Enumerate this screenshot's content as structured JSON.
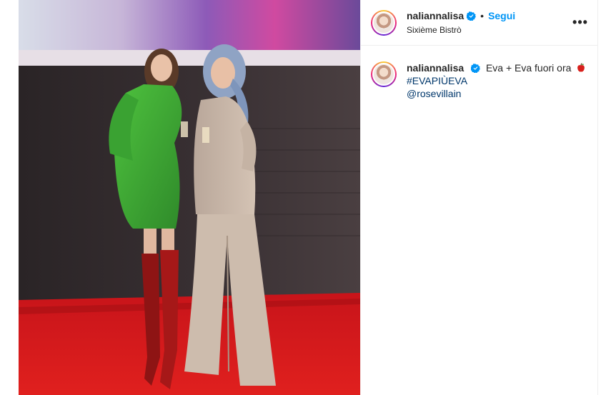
{
  "post": {
    "username": "naliannalisa",
    "follow_label": "Segui",
    "separator": "•",
    "location": "Sixième Bistrò",
    "more_label": "•••",
    "caption": {
      "username": "naliannalisa",
      "text": "Eva + Eva fuori ora",
      "hashtag": "#EVAPIÙEVA",
      "mention": "@rosevillain"
    }
  },
  "icons": {
    "verified": "verified-badge-icon",
    "more": "more-options-icon",
    "emoji": "apple-emoji"
  },
  "colors": {
    "accent": "#0095f6",
    "link": "#00376b",
    "verified": "#0095f6",
    "border": "#efefef"
  }
}
